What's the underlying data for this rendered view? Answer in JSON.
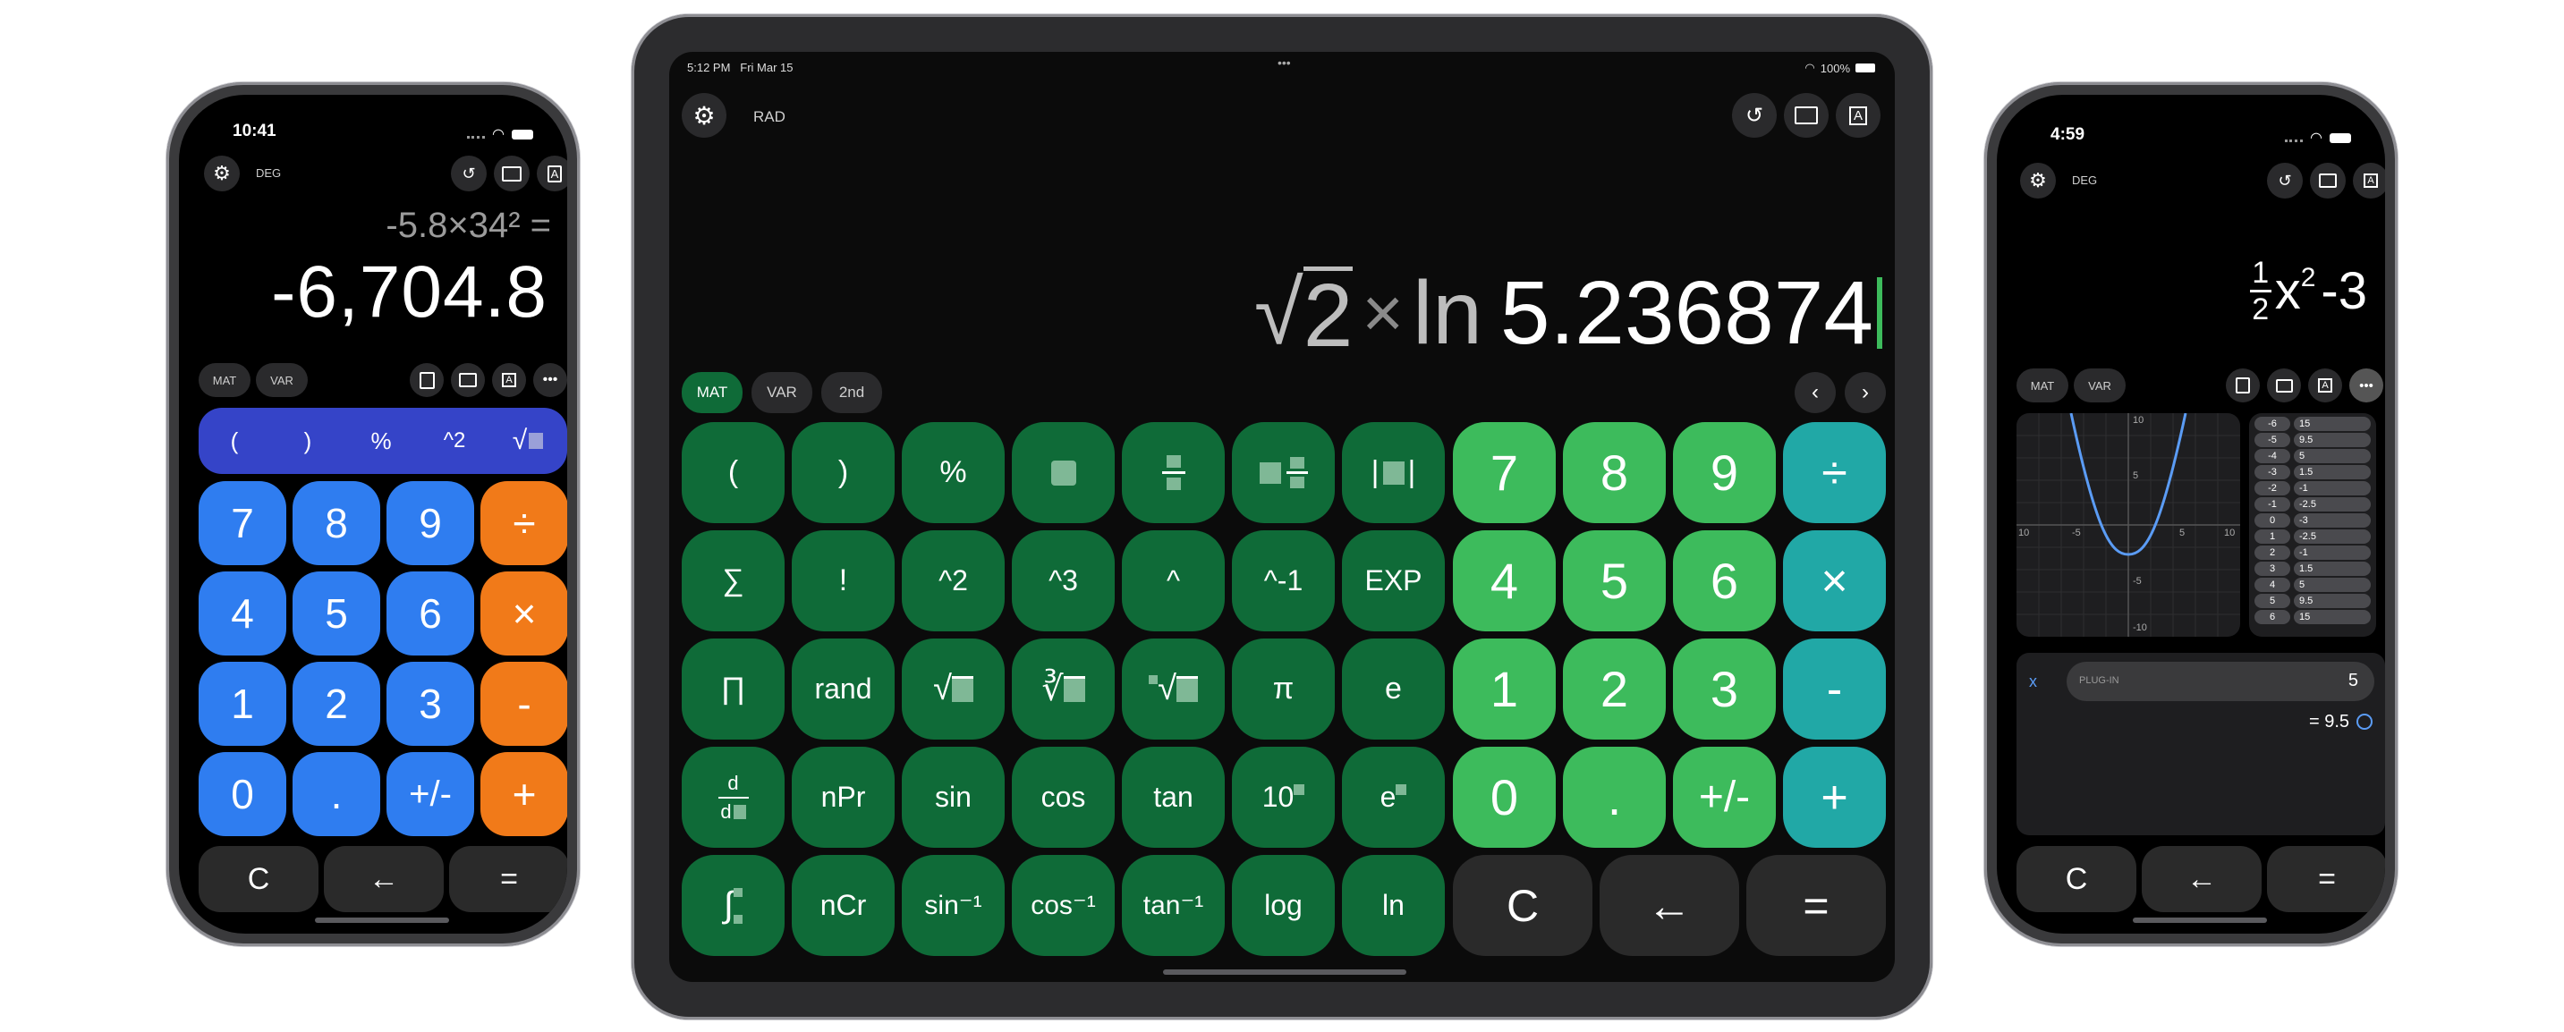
{
  "left_phone": {
    "time": "10:41",
    "mode": "DEG",
    "expression": "-5.8×34² =",
    "result": "-6,704.8",
    "pills": [
      "MAT",
      "VAR"
    ],
    "function_row": [
      "(",
      ")",
      "%",
      "^2",
      "√"
    ],
    "keys": [
      [
        "7",
        "8",
        "9",
        "÷"
      ],
      [
        "4",
        "5",
        "6",
        "×"
      ],
      [
        "1",
        "2",
        "3",
        "-"
      ],
      [
        "0",
        ".",
        "+/-",
        "+"
      ]
    ],
    "bottom": [
      "C",
      "←",
      "="
    ]
  },
  "tablet": {
    "time": "5:12 PM",
    "date": "Fri Mar 15",
    "battery": "100%",
    "mode": "RAD",
    "expression": "√2 × ln 5.236874",
    "expr_parts": {
      "root_arg": "2",
      "times": "×",
      "fn": "ln",
      "number": "5.236874"
    },
    "pills": [
      "MAT",
      "VAR",
      "2nd"
    ],
    "func_keys": [
      [
        "(",
        ")",
        "%",
        "▪",
        "▪/▪",
        "▪ ▪/▪",
        "|▪|"
      ],
      [
        "∑",
        "!",
        "^2",
        "^3",
        "^",
        "^-1",
        "EXP"
      ],
      [
        "∏",
        "rand",
        "√▪",
        "∛▪",
        "ⁿ√▪",
        "π",
        "e"
      ],
      [
        "d/d▪",
        "nPr",
        "sin",
        "cos",
        "tan",
        "10▪",
        "e▪"
      ],
      [
        "∫▪",
        "nCr",
        "sin⁻¹",
        "cos⁻¹",
        "tan⁻¹",
        "log",
        "ln"
      ]
    ],
    "num_keys": [
      [
        "7",
        "8",
        "9",
        "÷"
      ],
      [
        "4",
        "5",
        "6",
        "×"
      ],
      [
        "1",
        "2",
        "3",
        "-"
      ],
      [
        "0",
        ".",
        "+/-",
        "+"
      ]
    ],
    "bottom": [
      "C",
      "←",
      "="
    ]
  },
  "right_phone": {
    "time": "4:59",
    "mode": "DEG",
    "expression": "½x² − 3",
    "expr_parts": {
      "num": "1",
      "den": "2",
      "var": "x",
      "exp": "2",
      "rest": "-3"
    },
    "pills": [
      "MAT",
      "VAR"
    ],
    "graph_ticks": {
      "top": "10",
      "bottom": "-10",
      "left": "10",
      "right": "10",
      "xn": "-5",
      "xp": "5",
      "yp": "5",
      "yn": "-5"
    },
    "table": [
      [
        "-6",
        "15"
      ],
      [
        "-5",
        "9.5"
      ],
      [
        "-4",
        "5"
      ],
      [
        "-3",
        "1.5"
      ],
      [
        "-2",
        "-1"
      ],
      [
        "-1",
        "-2.5"
      ],
      [
        "0",
        "-3"
      ],
      [
        "1",
        "-2.5"
      ],
      [
        "2",
        "-1"
      ],
      [
        "3",
        "1.5"
      ],
      [
        "4",
        "5"
      ],
      [
        "5",
        "9.5"
      ],
      [
        "6",
        "15"
      ]
    ],
    "plugin_var": "x",
    "plugin_label": "PLUG-IN",
    "plugin_value": "5",
    "plugin_result": "= 9.5",
    "bottom": [
      "C",
      "←",
      "="
    ]
  },
  "colors": {
    "phone_blue": "#2f7df0",
    "phone_orange": "#f17a19",
    "phone_indigo": "#3544c8",
    "tab_dark_green": "#0f6b38",
    "tab_light_green": "#3dbb5c",
    "tab_teal": "#21a8a6",
    "key_dark": "#2a2a2a"
  }
}
